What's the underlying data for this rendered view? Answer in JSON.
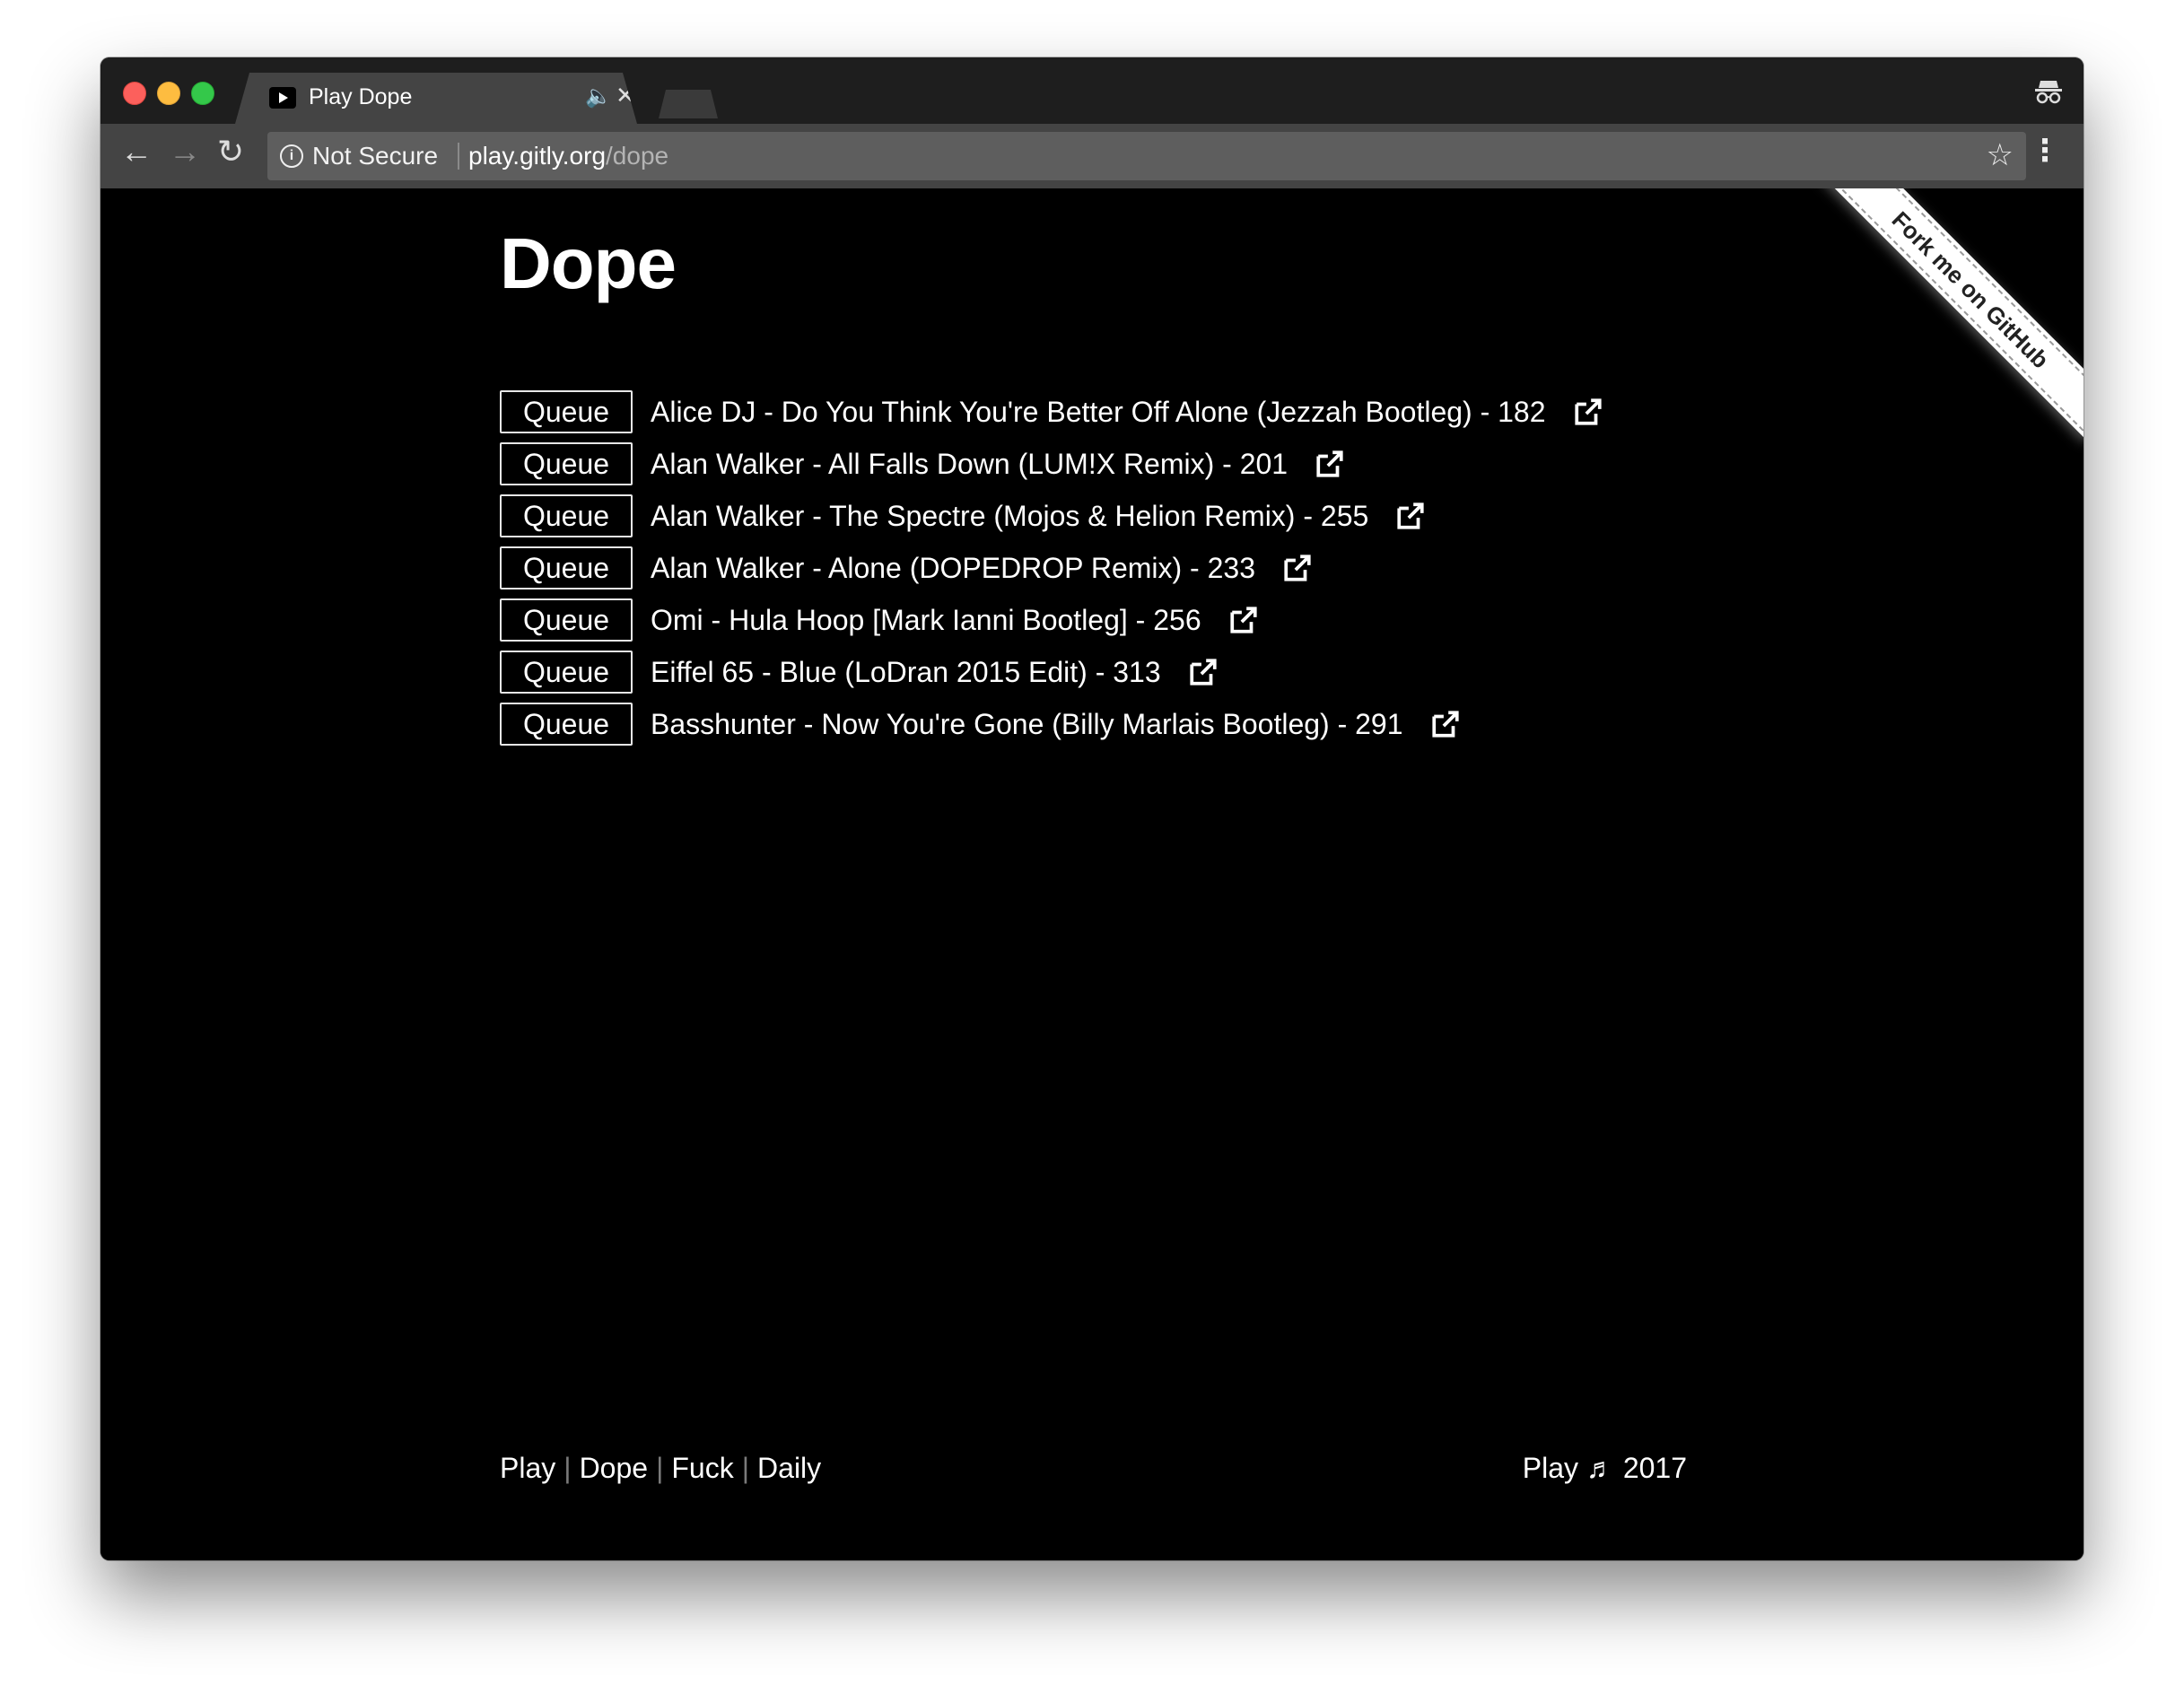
{
  "browser": {
    "tab_title": "Play Dope",
    "tab_audio_icon": "speaker-icon",
    "tab_close_symbol": "✕",
    "security_label": "Not Secure",
    "url_host": "play.gitly.org",
    "url_path": "/dope"
  },
  "page": {
    "title": "Dope",
    "queue_label": "Queue",
    "tracks": [
      "Alice DJ - Do You Think You're Better Off Alone (Jezzah Bootleg) - 182",
      "Alan Walker - All Falls Down (LUM!X Remix) - 201",
      "Alan Walker - The Spectre (Mojos & Helion Remix) - 255",
      "Alan Walker - Alone (DOPEDROP Remix) - 233",
      "Omi - Hula Hoop [Mark Ianni Bootleg] - 256",
      "Eiffel 65 - Blue (LoDran 2015 Edit) - 313",
      "Basshunter - Now You're Gone (Billy Marlais Bootleg) - 291"
    ],
    "ribbon": "Fork me on GitHub"
  },
  "footer": {
    "links": [
      "Play",
      "Dope",
      "Fuck",
      "Daily"
    ],
    "separator": "|",
    "copyright": "Play ♬ 2017"
  },
  "colors": {
    "page_background": "#000000",
    "text": "#ffffff",
    "toolbar": "#444444",
    "tabbar": "#1e1e1e"
  }
}
